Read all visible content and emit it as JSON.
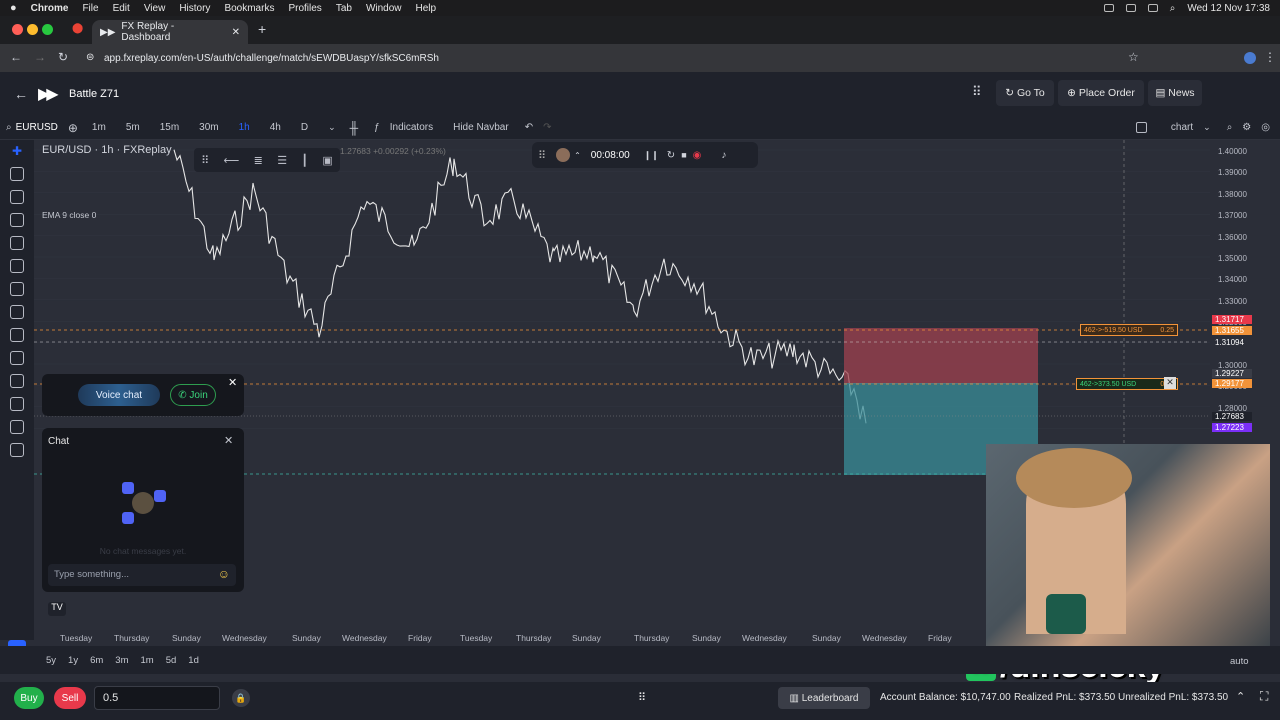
{
  "macos": {
    "app": "Chrome",
    "menus": [
      "File",
      "Edit",
      "View",
      "History",
      "Bookmarks",
      "Profiles",
      "Tab",
      "Window",
      "Help"
    ],
    "clock": "Wed 12 Nov 17:38"
  },
  "browser": {
    "tab_title": "FX Replay - Dashboard",
    "url": "app.fxreplay.com/en-US/auth/challenge/match/sEWDBUaspY/sfkSC6mRSh"
  },
  "header": {
    "title": "Battle Z71",
    "timeframe": "1h",
    "goto": "Go To",
    "place_order": "Place Order",
    "news": "News"
  },
  "toolbar": {
    "symbol": "EURUSD",
    "timeframes": [
      "1m",
      "5m",
      "15m",
      "30m",
      "1h",
      "4h",
      "D"
    ],
    "active_tf": "1h",
    "indicators": "Indicators",
    "hide_navbar": "Hide Navbar",
    "chart_label": "chart"
  },
  "chart": {
    "legend_title": "EUR/USD · 1h · FXReplay",
    "legend_values": "1.27683 +0.00292 (+0.23%)",
    "ema": "EMA 9 close 0",
    "replay_time": "00:08:00",
    "yticks": [
      "1.40000",
      "1.39000",
      "1.38000",
      "1.37000",
      "1.36000",
      "1.35000",
      "1.34000",
      "1.33000",
      "1.32000",
      "1.31000",
      "1.30000",
      "1.29000",
      "1.28000"
    ],
    "ylabels": [
      {
        "t": "1.31717",
        "c": "#e8394b"
      },
      {
        "t": "1.31655",
        "c": "#f29339"
      },
      {
        "t": "1.31094",
        "c": "#2b2e38"
      },
      {
        "t": "1.29227",
        "c": "#3a3d47"
      },
      {
        "t": "1.29177",
        "c": "#f29339"
      },
      {
        "t": "1.27683",
        "c": "#1f222b"
      },
      {
        "t": "1.27223",
        "c": "#7b2ff7"
      }
    ],
    "tp_label": "462->-519.50 USD",
    "sl_label": "462->373.50 USD",
    "qty": "0.25",
    "xticks": [
      "Tuesday",
      "Thursday",
      "Sunday",
      "Wednesday",
      "Sunday",
      "Wednesday",
      "Friday",
      "Tuesday",
      "Thursday",
      "Sunday",
      "Thursday",
      "Sunday",
      "Wednesday",
      "Sunday",
      "Wednesday",
      "Friday"
    ]
  },
  "voice": {
    "label": "Voice chat",
    "join": "Join"
  },
  "chat": {
    "title": "Chat",
    "empty": "No chat messages yet.",
    "placeholder": "Type something..."
  },
  "ranges": [
    "5y",
    "1y",
    "6m",
    "3m",
    "1m",
    "5d",
    "1d"
  ],
  "bottom": {
    "buy": "Buy",
    "sell": "Sell",
    "qty": "0.5",
    "leaderboard": "Leaderboard",
    "balance": "Account Balance: $10,747.00",
    "realized": "Realized PnL: $373.50",
    "unrealized": "Unrealized PnL: $373.50",
    "auto": "auto"
  },
  "overlay_name": "/dinseleky"
}
